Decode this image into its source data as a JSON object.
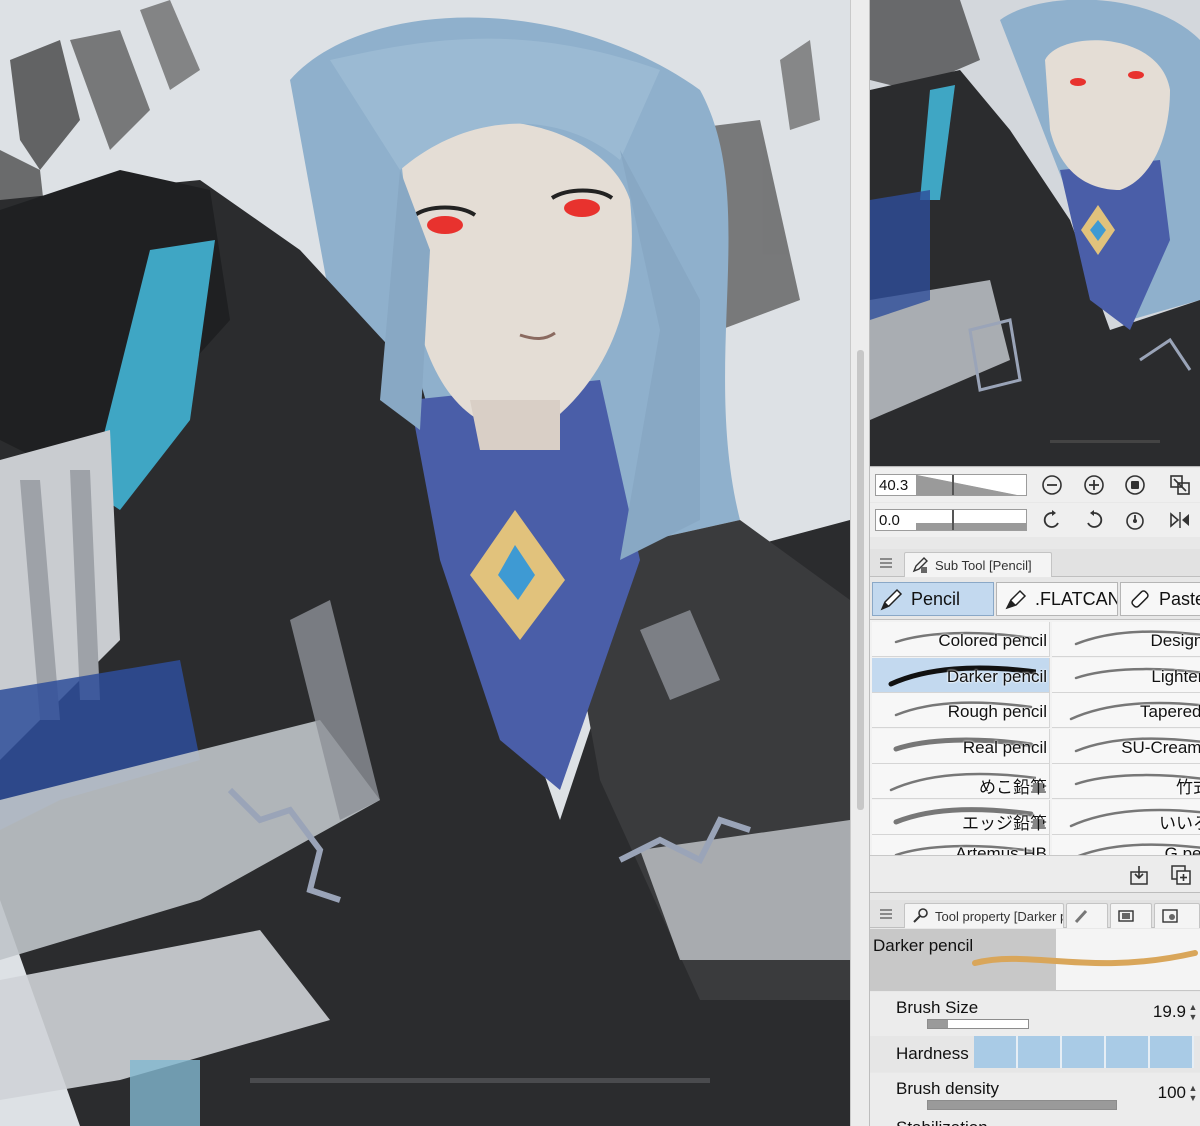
{
  "navigator": {
    "zoom_value": "40.3",
    "rotate_value": "0.0",
    "icons": [
      "zoom-out-icon",
      "zoom-in-icon",
      "fit-view-icon",
      "fit-window-icon",
      "rotate-left-icon",
      "rotate-right-icon",
      "reset-rotation-icon",
      "flip-horizontal-icon"
    ]
  },
  "sub_tool": {
    "tab_label": "Sub Tool [Pencil]",
    "groups": [
      {
        "label": "Pencil",
        "icon": "pencil-icon",
        "active": true
      },
      {
        "label": ".FLATCAN",
        "icon": "marker-icon",
        "active": false
      },
      {
        "label": "Paste",
        "icon": "pastel-icon",
        "active": false
      }
    ],
    "brushes": [
      {
        "label": "Colored pencil",
        "active": false
      },
      {
        "label": "Design pe",
        "active": false
      },
      {
        "label": "Darker pencil",
        "active": true
      },
      {
        "label": "Lighter pe",
        "active": false
      },
      {
        "label": "Rough pencil",
        "active": false
      },
      {
        "label": "Tapered Pe",
        "active": false
      },
      {
        "label": "Real pencil",
        "active": false
      },
      {
        "label": "SU-Cream Pe",
        "active": false
      },
      {
        "label": "めこ鉛筆",
        "active": false
      },
      {
        "label": "竹式鉛",
        "active": false
      },
      {
        "label": "エッジ鉛筆",
        "active": false
      },
      {
        "label": "いいろ鉛",
        "active": false
      },
      {
        "label": "Artemus HB",
        "active": false
      },
      {
        "label": "G pencil",
        "active": false
      }
    ],
    "footer_icons": [
      "import-icon",
      "duplicate-icon"
    ]
  },
  "tool_property": {
    "tab_label": "Tool property [Darker pencil]",
    "brush_name": "Darker pencil",
    "properties": {
      "brush_size": {
        "label": "Brush Size",
        "value": "19.9",
        "fraction": 0.2
      },
      "hardness": {
        "label": "Hardness"
      },
      "brush_density": {
        "label": "Brush density",
        "value": "100",
        "fraction": 1.0
      },
      "stabilization": {
        "label": "Stabilization"
      }
    }
  },
  "colors": {
    "accent": "#c3d9ef",
    "hair": "#8fb0cc",
    "shirt": "#4a5ea8",
    "eyes": "#e8322e",
    "coat": "#2b2c2e",
    "background": "#dde1e5"
  }
}
